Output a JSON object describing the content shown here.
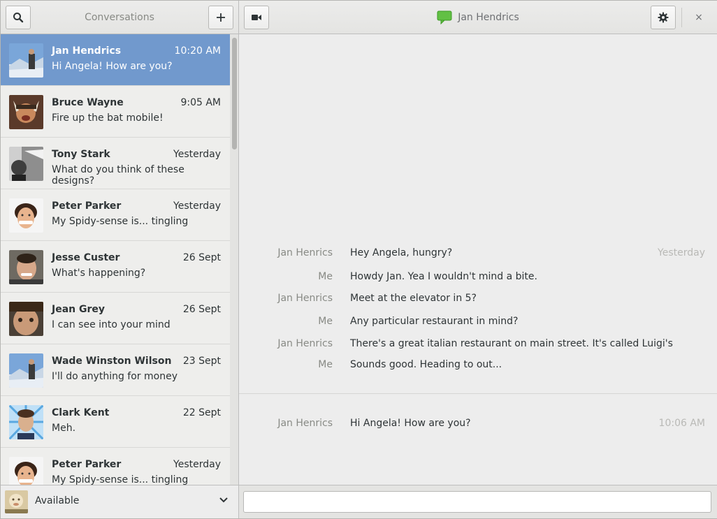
{
  "left_header": {
    "title": "Conversations",
    "search_icon": "search-icon",
    "add_icon": "plus-icon"
  },
  "right_header": {
    "video_icon": "video-camera-icon",
    "contact_name": "Jan Hendrics",
    "status_icon": "chat-bubble-icon",
    "status_color": "#5fbf3f",
    "settings_icon": "gear-icon",
    "close_label": "×"
  },
  "conversations": [
    {
      "name": "Jan Hendrics",
      "time": "10:20 AM",
      "message": "Hi Angela! How are you?",
      "selected": true
    },
    {
      "name": "Bruce Wayne",
      "time": "9:05 AM",
      "message": "Fire up the bat mobile!"
    },
    {
      "name": "Tony Stark",
      "time": "Yesterday",
      "message": "What do you think of these designs?"
    },
    {
      "name": "Peter Parker",
      "time": "Yesterday",
      "message": "My Spidy-sense is... tingling"
    },
    {
      "name": "Jesse Custer",
      "time": "26 Sept",
      "message": "What's happening?"
    },
    {
      "name": "Jean Grey",
      "time": "26 Sept",
      "message": "I can see into your mind"
    },
    {
      "name": "Wade Winston Wilson",
      "time": "23 Sept",
      "message": "I'll do anything for money"
    },
    {
      "name": "Clark Kent",
      "time": "22 Sept",
      "message": "Meh."
    },
    {
      "name": "Peter Parker",
      "time": "Yesterday",
      "message": "My Spidy-sense is... tingling"
    }
  ],
  "status": {
    "label": "Available",
    "chevron_icon": "chevron-down-icon"
  },
  "messages": [
    {
      "sender": "Jan Henrics",
      "text": "Hey Angela, hungry?",
      "stamp": "Yesterday"
    },
    {
      "sender": "Me",
      "text": "Howdy Jan. Yea I wouldn't mind a bite."
    },
    {
      "sender": "Jan Henrics",
      "text": "Meet at the elevator in 5?"
    },
    {
      "sender": "Me",
      "text": "Any particular restaurant in mind?"
    },
    {
      "sender": "Jan Henrics",
      "text": "There's a great italian restaurant on main street. It's called Luigi's"
    },
    {
      "sender": "Me",
      "text": "Sounds good. Heading to out..."
    }
  ],
  "latest_message": {
    "sender": "Jan Henrics",
    "text": "Hi Angela! How are you?",
    "stamp": "10:06 AM"
  },
  "compose": {
    "value": "",
    "placeholder": ""
  },
  "colors": {
    "selection": "#7199cd",
    "accent_green": "#5fbf3f"
  }
}
